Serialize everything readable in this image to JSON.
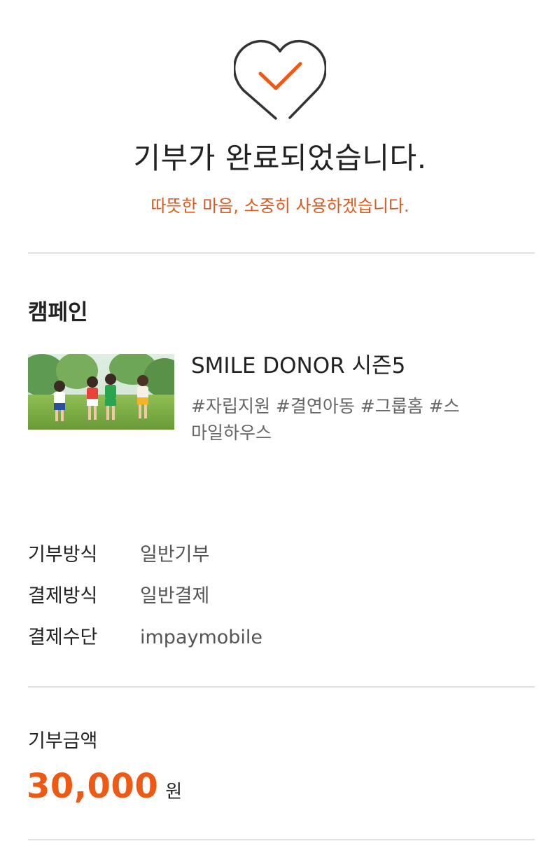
{
  "hero": {
    "title": "기부가 완료되었습니다.",
    "subtitle": "따뜻한 마음, 소중히 사용하겠습니다.",
    "icon": "heart-check-icon",
    "accent_color": "#ee5a13"
  },
  "campaign": {
    "section_title": "캠페인",
    "name": "SMILE DONOR 시즌5",
    "tags": "#자립지원 #결연아동 #그룹홈 #스마일하우스"
  },
  "details": [
    {
      "label": "기부방식",
      "value": "일반기부"
    },
    {
      "label": "결제방식",
      "value": "일반결제"
    },
    {
      "label": "결제수단",
      "value": "impaymobile"
    }
  ],
  "donation": {
    "label": "기부금액",
    "amount": "30,000",
    "unit": "원"
  }
}
